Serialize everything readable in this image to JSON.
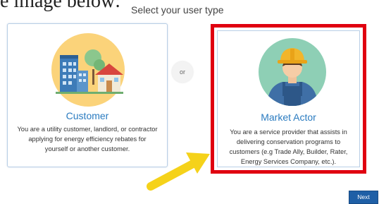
{
  "top_text": "e image below:",
  "page_title": "Select your user type",
  "or_label": "or",
  "customer": {
    "title": "Customer",
    "description": "You are a utility customer, landlord, or contractor applying for energy efficiency rebates for yourself or another customer."
  },
  "market_actor": {
    "title": "Market Actor",
    "description": "You are a service provider that assists in delivering conservation programs to customers (e.g Trade Ally, Builder, Rater, Energy Services Company, etc.)."
  },
  "next_label": "Next",
  "colors": {
    "accent_blue": "#2a7bc0",
    "highlight_red": "#e00010",
    "arrow_yellow": "#f5d21a",
    "button_blue": "#1f5fa6"
  },
  "icons": {
    "customer": "buildings-house-icon",
    "market_actor": "worker-hardhat-icon",
    "pointer": "arrow-pointer-icon"
  }
}
